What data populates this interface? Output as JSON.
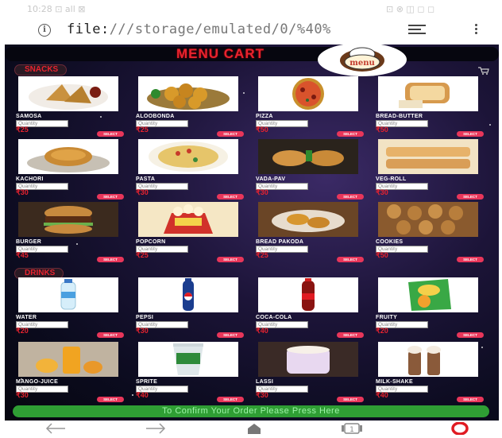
{
  "status_bar": {
    "time": "10:28 ⊡ all ⊠",
    "right": "⊡ ⊗ ◫ ◻ ◻"
  },
  "address_bar": {
    "info_symbol": "i",
    "url_prefix": "file:",
    "url_main": "///storage/emulated/0/%40%",
    "reader_icon": "reader-mode-icon",
    "menu_icon": "more-vert-icon"
  },
  "header": {
    "title": "MENU CART",
    "logo_text": "menu",
    "cart_icon": "shopping-cart-icon"
  },
  "sections": {
    "snacks": "SNACKS",
    "drinks": "DRINKS"
  },
  "quantity_placeholder": "Quantity",
  "select_label": "SELECT",
  "items": [
    {
      "name": "SAMOSA",
      "price": "₹25",
      "image": "samosa-image"
    },
    {
      "name": "ALOOBONDA",
      "price": "₹25",
      "image": "aloobonda-image"
    },
    {
      "name": "PIZZA",
      "price": "₹50",
      "image": "pizza-image"
    },
    {
      "name": "BREAD-BUTTER",
      "price": "₹50",
      "image": "bread-butter-image"
    },
    {
      "name": "KACHORI",
      "price": "₹30",
      "image": "kachori-image"
    },
    {
      "name": "PASTA",
      "price": "₹30",
      "image": "pasta-image"
    },
    {
      "name": "VADA-PAV",
      "price": "₹30",
      "image": "vada-pav-image"
    },
    {
      "name": "VEG-ROLL",
      "price": "₹30",
      "image": "veg-roll-image"
    },
    {
      "name": "BURGER",
      "price": "₹45",
      "image": "burger-image"
    },
    {
      "name": "POPCORN",
      "price": "₹25",
      "image": "popcorn-image"
    },
    {
      "name": "BREAD PAKODA",
      "price": "₹25",
      "image": "bread-pakoda-image"
    },
    {
      "name": "COOKIES",
      "price": "₹50",
      "image": "cookies-image"
    },
    {
      "name": "WATER",
      "price": "₹20",
      "image": "water-bottle-image"
    },
    {
      "name": "PEPSI",
      "price": "₹30",
      "image": "pepsi-image"
    },
    {
      "name": "COCA-COLA",
      "price": "₹40",
      "image": "coca-cola-image"
    },
    {
      "name": "FRUITY",
      "price": "₹20",
      "image": "frooti-image"
    },
    {
      "name": "MANGO-JUICE",
      "price": "₹30",
      "image": "mango-juice-image"
    },
    {
      "name": "SPRITE",
      "price": "₹40",
      "image": "sprite-image"
    },
    {
      "name": "LASSI",
      "price": "₹30",
      "image": "lassi-image"
    },
    {
      "name": "MILK-SHAKE",
      "price": "₹40",
      "image": "milkshake-image"
    }
  ],
  "confirm_button": "To Confirm Your Order Please Press Here",
  "nav_bar": {
    "back_icon": "back-arrow-icon",
    "forward_icon": "forward-arrow-icon",
    "home_icon": "home-icon",
    "tabs_icon": "tabs-icon",
    "tabs_count": "1",
    "opera_icon": "opera-logo-icon"
  },
  "colors": {
    "accent": "#e8232f",
    "confirm": "#2f9e34",
    "select": "#e8365a"
  }
}
